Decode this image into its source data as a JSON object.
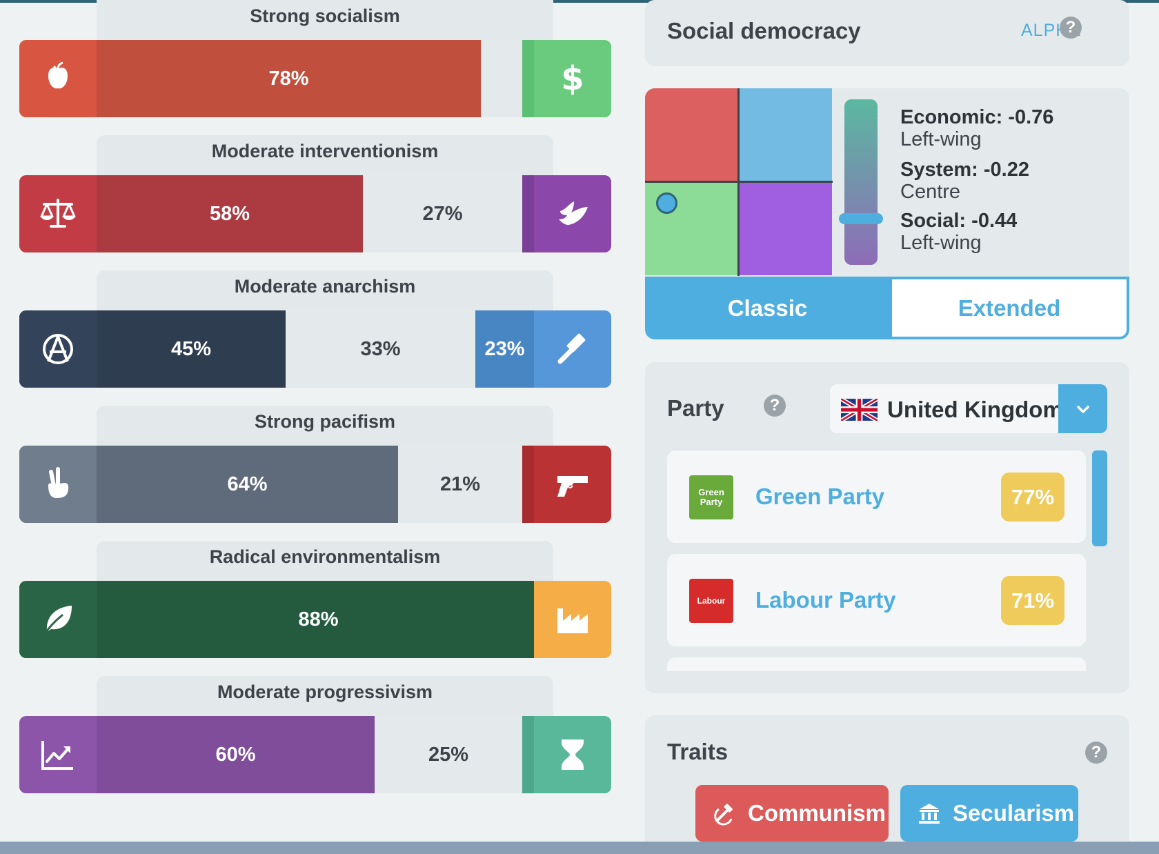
{
  "colors": {
    "accent": "#4eaedf",
    "yellow_badge": "#eecb5a",
    "text_dark": "#3d4449"
  },
  "axes": [
    {
      "title": "Strong socialism",
      "left_icon": "apple-icon",
      "right_icon": "dollar-icon",
      "left_pct": "78%",
      "mid_pct": "",
      "right_pct": "",
      "left_share": 78,
      "right_share": 15,
      "left_color": "#c14f3e",
      "left_icon_color": "#d85541",
      "right_color": "#5bc074",
      "right_icon_color": "#6acb7e"
    },
    {
      "title": "Moderate interventionism",
      "left_icon": "scales-icon",
      "right_icon": "dove-icon",
      "left_pct": "58%",
      "mid_pct": "27%",
      "right_pct": "",
      "left_share": 58,
      "right_share": 15,
      "left_color": "#ac3a41",
      "left_icon_color": "#c13c45",
      "right_color": "#7a3f97",
      "right_icon_color": "#8b47aa"
    },
    {
      "title": "Moderate anarchism",
      "left_icon": "anarchy-icon",
      "right_icon": "gavel-icon",
      "left_pct": "45%",
      "mid_pct": "33%",
      "right_pct": "23%",
      "left_share": 45,
      "right_share": 23,
      "left_color": "#2e3d4f",
      "left_icon_color": "#33435a",
      "right_color": "#4886c3",
      "right_icon_color": "#5597d8"
    },
    {
      "title": "Strong pacifism",
      "left_icon": "peace-hand-icon",
      "right_icon": "gun-icon",
      "left_pct": "64%",
      "mid_pct": "21%",
      "right_pct": "",
      "left_share": 64,
      "right_share": 15,
      "left_color": "#5f6b7a",
      "left_icon_color": "#707d8c",
      "right_color": "#a72c2f",
      "right_icon_color": "#bb3234"
    },
    {
      "title": "Radical environmentalism",
      "left_icon": "leaf-icon",
      "right_icon": "factory-icon",
      "left_pct": "88%",
      "mid_pct": "",
      "right_pct": "",
      "left_share": 88,
      "right_share": 12,
      "left_color": "#245b3e",
      "left_icon_color": "#2a6446",
      "right_color": "#f0a63f",
      "right_icon_color": "#f5ad47"
    },
    {
      "title": "Moderate progressivism",
      "left_icon": "chart-up-icon",
      "right_icon": "hourglass-icon",
      "left_pct": "60%",
      "mid_pct": "25%",
      "right_pct": "",
      "left_share": 60,
      "right_share": 15,
      "left_color": "#7f4d99",
      "left_icon_color": "#8d55aa",
      "right_color": "#4ea68b",
      "right_icon_color": "#5ab89a"
    }
  ],
  "ideology": {
    "title": "Social democracy",
    "badge": "ALPHA",
    "help": "?"
  },
  "compass": {
    "economic_label": "Economic:",
    "economic_value": "-0.76",
    "economic_desc": "Left-wing",
    "system_label": "System:",
    "system_value": "-0.22",
    "system_desc": "Centre",
    "social_label": "Social:",
    "social_value": "-0.44",
    "social_desc": "Left-wing",
    "tabs": [
      "Classic",
      "Extended"
    ]
  },
  "party": {
    "title": "Party",
    "help": "?",
    "country": "United Kingdom",
    "rows": [
      {
        "name": "Green Party",
        "pct": "77%",
        "logo": "Green\nParty",
        "logo_color": "#6aaa3a"
      },
      {
        "name": "Labour Party",
        "pct": "71%",
        "logo": "Labour",
        "logo_color": "#d52b2b"
      }
    ]
  },
  "traits": {
    "title": "Traits",
    "help": "?",
    "items": [
      {
        "label": "Communism",
        "icon": "hammer-sickle-icon",
        "color": "#dd5a5a"
      },
      {
        "label": "Secularism",
        "icon": "institution-icon",
        "color": "#4eaedf"
      }
    ]
  }
}
